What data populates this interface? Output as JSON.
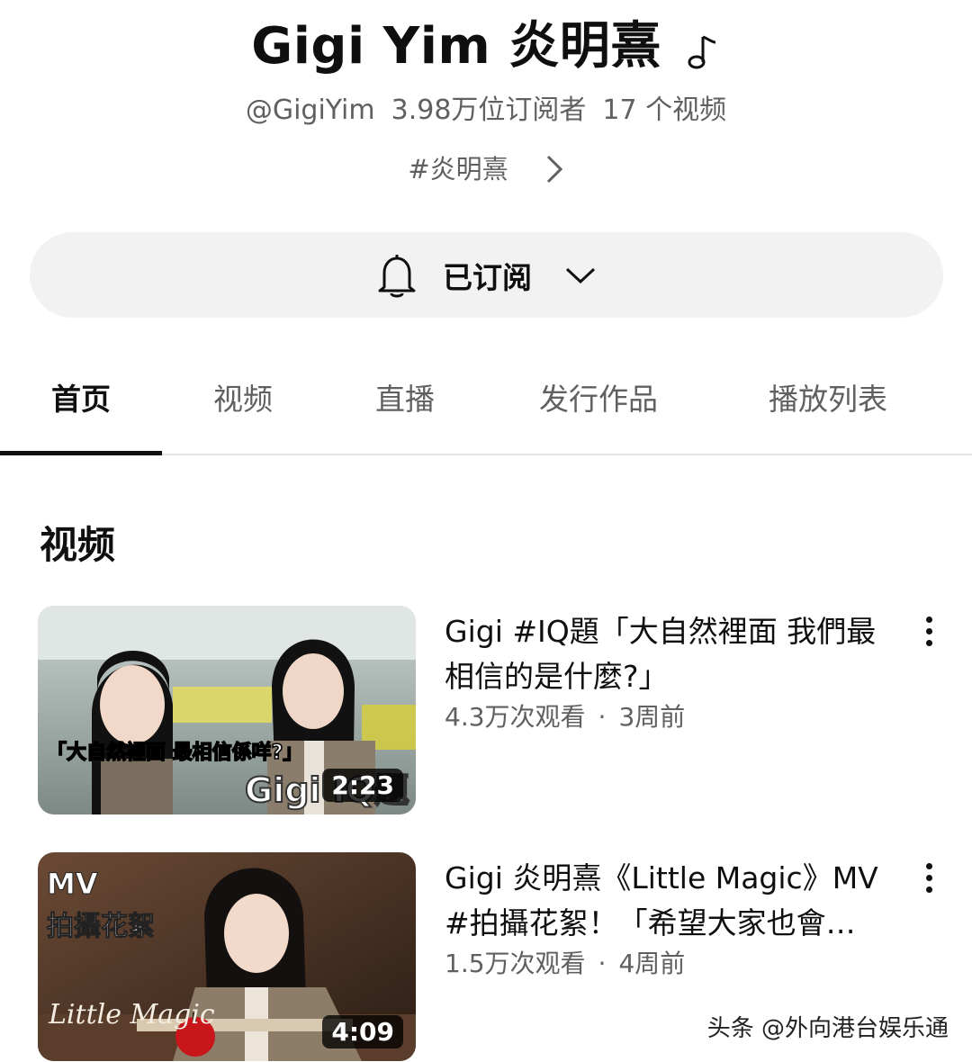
{
  "channel": {
    "name": "Gigi Yim 炎明熹",
    "handle": "@GigiYim",
    "subscribers": "3.98万位订阅者",
    "video_count": "17 个视频",
    "hashtag": "#炎明熹"
  },
  "subscribe": {
    "label": "已订阅"
  },
  "tabs": [
    {
      "label": "首页",
      "active": true
    },
    {
      "label": "视频"
    },
    {
      "label": "直播"
    },
    {
      "label": "发行作品"
    },
    {
      "label": "播放列表"
    }
  ],
  "section": {
    "title": "视频"
  },
  "videos": [
    {
      "title": "Gigi #IQ題「大自然裡面 我們最相信的是什麼?」",
      "views": "4.3万次观看",
      "separator": "·",
      "age": "3周前",
      "duration": "2:23",
      "thumb_caption": "「大自然裡面 最相信係咩?」",
      "thumb_logo": "Gigi IQ題"
    },
    {
      "title": "Gigi 炎明熹《Little Magic》MV #拍攝花絮！「希望大家也會…",
      "views": "1.5万次观看",
      "separator": "·",
      "age": "4周前",
      "duration": "4:09",
      "thumb_caption_line1": "MV",
      "thumb_caption_line2": "拍攝花絮",
      "thumb_logo": "Little Magic"
    }
  ],
  "watermark": "头条 @外向港台娱乐通",
  "colors": {
    "text_primary": "#0f0f0f",
    "text_secondary": "#606060",
    "pill_bg": "#f2f2f2"
  }
}
